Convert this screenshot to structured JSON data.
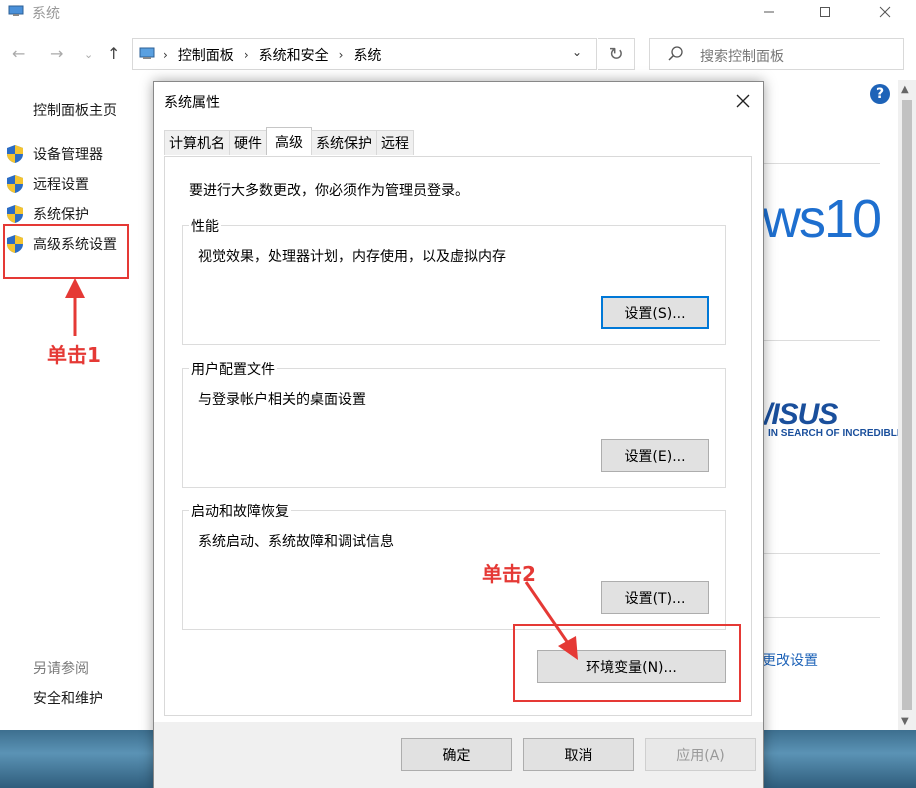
{
  "parent_window": {
    "title": "系统",
    "breadcrumbs": [
      "控制面板",
      "系统和安全",
      "系统"
    ],
    "search_placeholder": "搜索控制面板"
  },
  "sidebar": {
    "home": "控制面板主页",
    "items": [
      {
        "label": "设备管理器",
        "icon": "shield-icon"
      },
      {
        "label": "远程设置",
        "icon": "shield-icon"
      },
      {
        "label": "系统保护",
        "icon": "shield-icon"
      },
      {
        "label": "高级系统设置",
        "icon": "shield-icon"
      }
    ],
    "see_also": "另请参阅",
    "security": "安全和维护"
  },
  "right_panel": {
    "windows_logo_text": "ws10",
    "brand": "/ISUS",
    "brand_tagline": "IN SEARCH OF INCREDIBLE",
    "change_settings_link": "更改设置"
  },
  "dialog": {
    "title": "系统属性",
    "tabs": [
      "计算机名",
      "硬件",
      "高级",
      "系统保护",
      "远程"
    ],
    "active_tab": "高级",
    "admin_notice": "要进行大多数更改，你必须作为管理员登录。",
    "groups": [
      {
        "label": "性能",
        "desc": "视觉效果，处理器计划，内存使用，以及虚拟内存",
        "button": "设置(S)..."
      },
      {
        "label": "用户配置文件",
        "desc": "与登录帐户相关的桌面设置",
        "button": "设置(E)..."
      },
      {
        "label": "启动和故障恢复",
        "desc": "系统启动、系统故障和调试信息",
        "button": "设置(T)..."
      }
    ],
    "env_button": "环境变量(N)...",
    "ok": "确定",
    "cancel": "取消",
    "apply": "应用(A)"
  },
  "annotations": {
    "step1": "单击1",
    "step2": "单击2",
    "color": "#e53935"
  }
}
